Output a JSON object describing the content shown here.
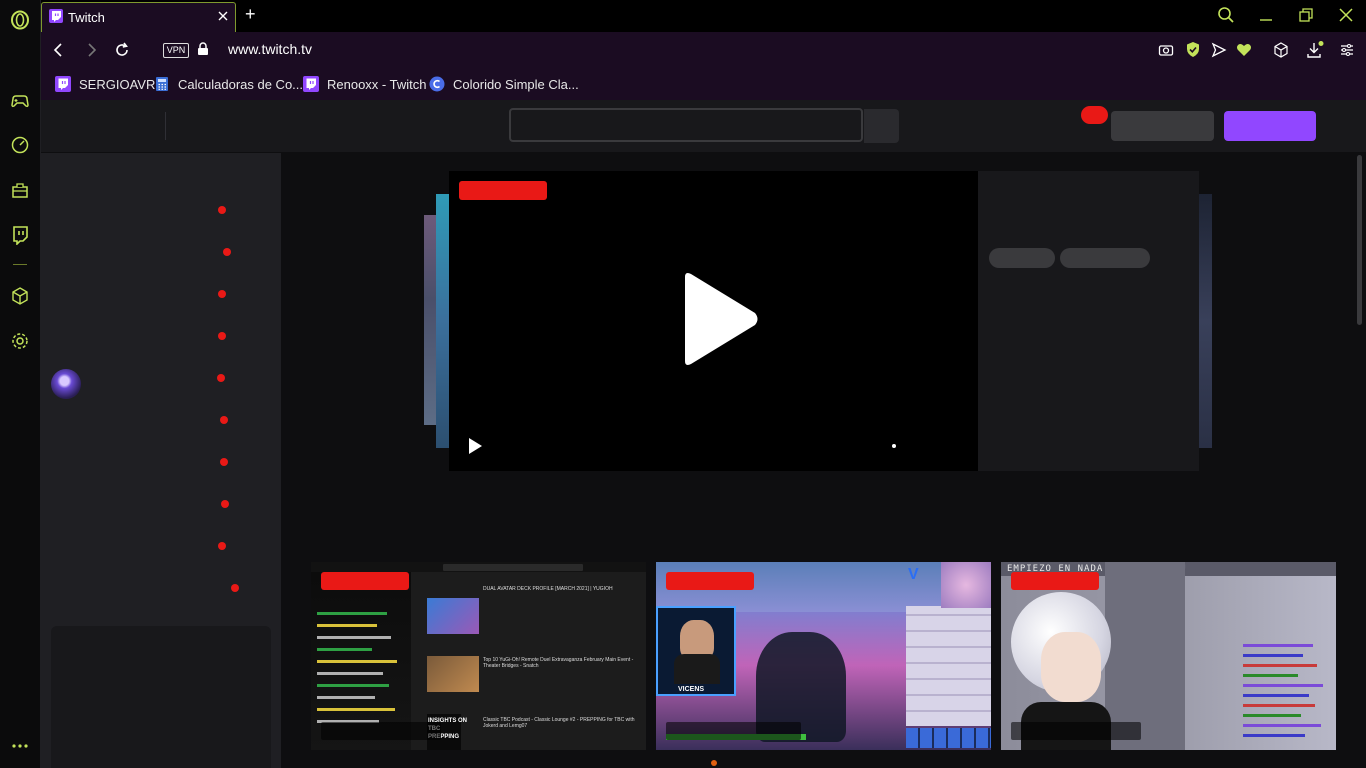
{
  "browser": {
    "tab_title": "Twitch",
    "new_tab_glyph": "+",
    "url": "www.twitch.tv",
    "vpn_label": "VPN",
    "accent": "#9a33ff",
    "frame_accent": "#7f9a2e",
    "bookmarks": [
      {
        "label": "SERGIOAVR",
        "icon": "twitch-icon"
      },
      {
        "label": "Calculadoras de Co...",
        "icon": "calculator-icon"
      },
      {
        "label": "Renooxx - Twitch",
        "icon": "twitch-icon"
      },
      {
        "label": "Colorido Simple Cla...",
        "icon": "c-circle-icon"
      }
    ],
    "rail_icons": [
      "opera-logo-icon",
      "gamepad-icon",
      "speedometer-icon",
      "briefcase-icon",
      "twitch-icon",
      "cube-icon",
      "gear-icon",
      "more-icon"
    ]
  },
  "twitch": {
    "brand_color": "#9147ff",
    "live_color": "#e91916",
    "cards": [
      {
        "name": "dual-avatar-stream",
        "overlay_text": "INSIGHTS ON TBC PREPPING",
        "video_titles": [
          "DUAL AVATAR DECK PROFILE [MARCH 2021] | YUGIOH",
          "Top 10 YuGi-Oh! Remote Duel Extravaganza February Main Event - Theater Bridges - Snatch",
          "Classic TBC Podcast - Classic Lounge #2 - PREPPING for TBC with Jokerd and Lemg07"
        ]
      },
      {
        "name": "fortnite-stream",
        "overlay_text": "VICENS",
        "video_titles": []
      },
      {
        "name": "anime-avatar-stream",
        "overlay_text": "EMPIEZO EN NADA... ESPERA TU",
        "video_titles": []
      }
    ]
  }
}
